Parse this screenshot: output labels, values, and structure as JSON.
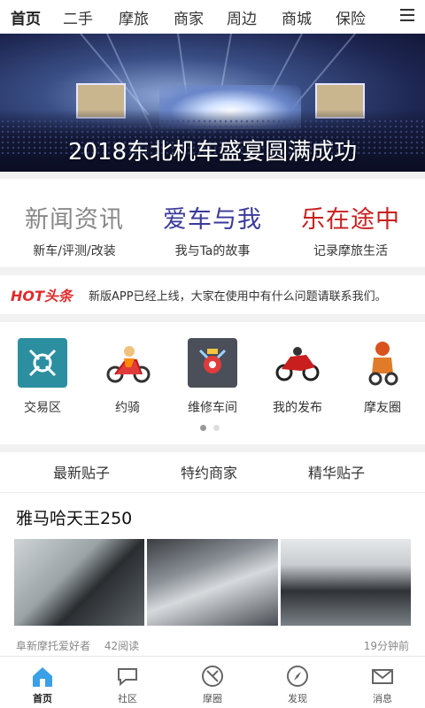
{
  "topnav": {
    "tabs": [
      "首页",
      "二手",
      "摩旅",
      "商家",
      "周边",
      "商城",
      "保险"
    ]
  },
  "banner": {
    "caption": "2018东北机车盛宴圆满成功"
  },
  "categories": [
    {
      "title": "新闻资讯",
      "subtitle": "新车/评测/改装",
      "color": "#888888"
    },
    {
      "title": "爱车与我",
      "subtitle": "我与Ta的故事",
      "color": "#3a3a9a"
    },
    {
      "title": "乐在途中",
      "subtitle": "记录摩旅生活",
      "color": "#c82020"
    }
  ],
  "hot": {
    "logo": "HOT头条",
    "message": "新版APP已经上线，大家在使用中有什么问题请联系我们。"
  },
  "icons": [
    {
      "label": "交易区",
      "icon": "trade-tools-icon"
    },
    {
      "label": "约骑",
      "icon": "scooter-ride-icon"
    },
    {
      "label": "维修车间",
      "icon": "repair-shop-icon"
    },
    {
      "label": "我的发布",
      "icon": "sport-bike-icon"
    },
    {
      "label": "摩友圈",
      "icon": "rider-icon"
    }
  ],
  "post_tabs": [
    "最新贴子",
    "特约商家",
    "精华贴子"
  ],
  "post": {
    "title": "雅马哈天王250",
    "author": "阜新摩托爱好者",
    "reads": "42阅读",
    "time": "19分钟前"
  },
  "bottom_nav": [
    "首页",
    "社区",
    "摩圈",
    "发现",
    "消息"
  ]
}
